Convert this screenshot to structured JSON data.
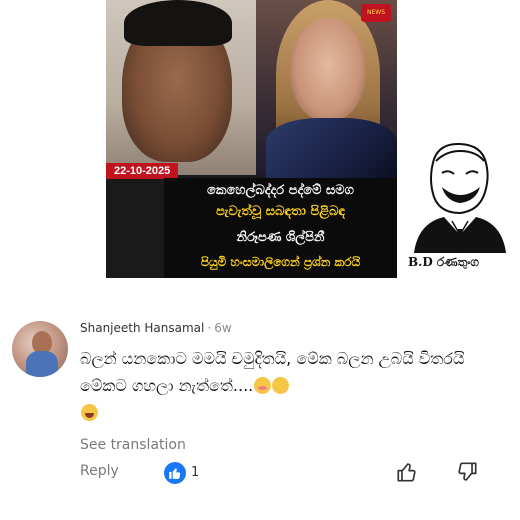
{
  "news": {
    "logo_text": "NEWS",
    "date": "22-10-2025",
    "headline_line1": "කෙහෙල්බද්දර පද්මේ සමග",
    "headline_line2": "පැවැත්වූ සබඳතා පිළිබඳ",
    "headline_line3": "නිරූපණ ශිල්පිනී",
    "headline_line4": "පියුමි හංසමාලිගෙන් ප්‍රශ්න කරයි"
  },
  "meme": {
    "caption": "B.D රණතුංග"
  },
  "comment": {
    "author": "Shanjeeth Hansamal",
    "separator": "·",
    "time": "6w",
    "text": "බලන් යනකොට මමයි චමුදිතයි, මේක බලන උබයි විතරයි මේකට ගහලා නැත්තේ....",
    "emoji_1": "flushed-face",
    "emoji_2": "face-with-hand-over-mouth",
    "emoji_3": "rolling-on-floor-laughing",
    "see_translation": "See translation",
    "reply_label": "Reply",
    "like_count": "1",
    "reaction_icon": "like-icon"
  },
  "colors": {
    "accent_blue": "#1877f2",
    "news_red": "#c1121f",
    "headline_yellow": "#ffd21a"
  }
}
